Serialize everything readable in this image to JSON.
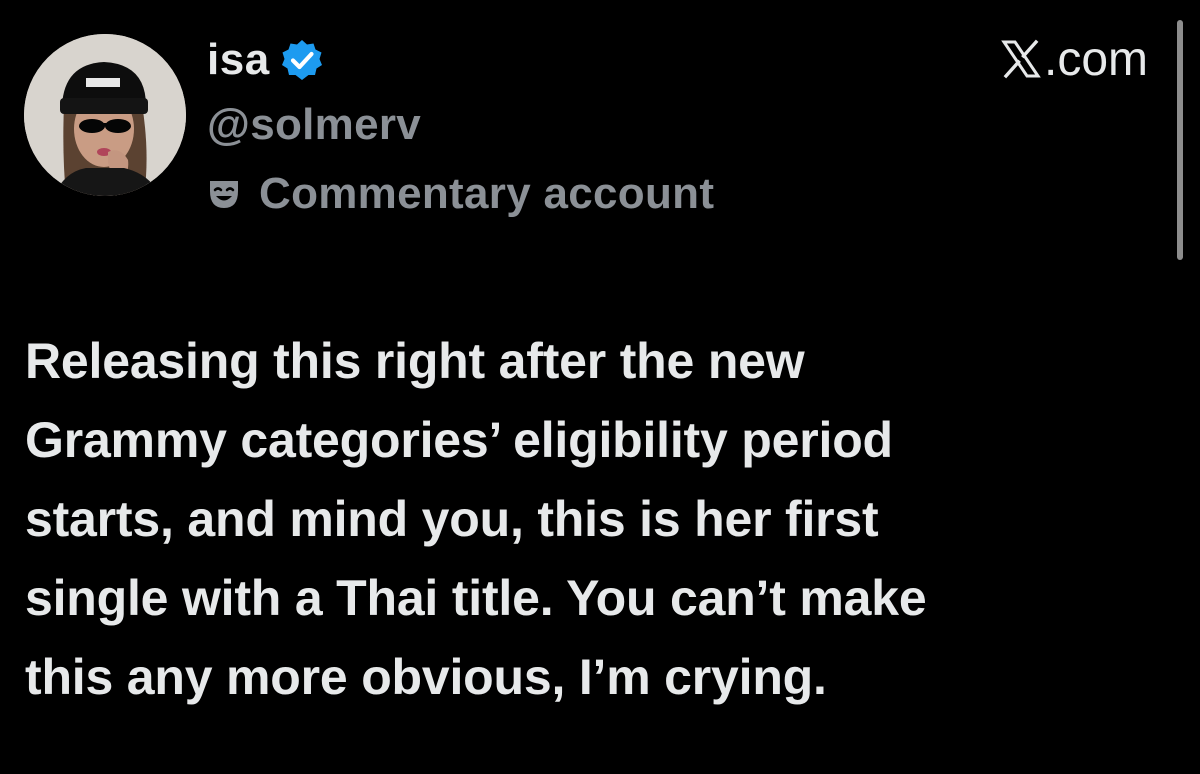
{
  "author": {
    "display_name": "isa",
    "handle": "@solmerv",
    "account_label": "Commentary account",
    "verified": true,
    "avatar": "profile-photo"
  },
  "source": {
    "site": ".com",
    "logo": "x-logo"
  },
  "post": {
    "lines": [
      "Releasing this right after the new",
      "Grammy categories’ eligibility period",
      "starts, and mind you, this is her first",
      "single with a Thai title. You can’t make",
      "this any more obvious, I’m crying."
    ]
  },
  "icons": {
    "verified": "verified-badge-icon",
    "label": "theater-mask-icon"
  },
  "colors": {
    "background": "#000000",
    "primary_text": "#e7e9ea",
    "secondary_text": "#8b9096",
    "verified_blue": "#1d9bf0"
  }
}
